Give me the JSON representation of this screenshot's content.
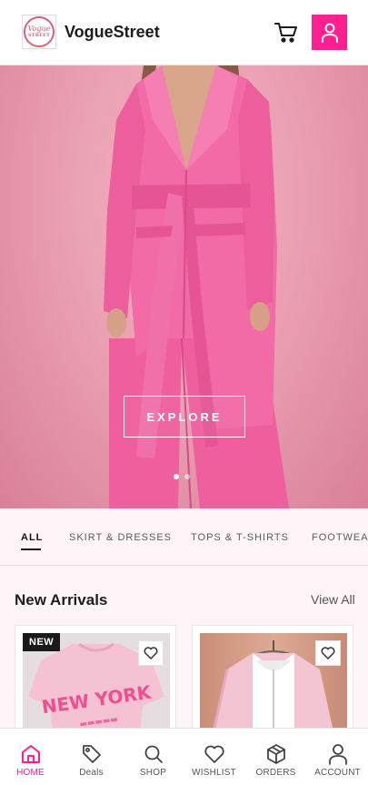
{
  "header": {
    "logo": {
      "line1": "Vogue",
      "line2": "STREET"
    },
    "brand": "VogueStreet",
    "cart_icon": "cart-icon",
    "account_icon": "user-icon"
  },
  "hero": {
    "cta_label": "EXPLORE",
    "slides": 2,
    "active_slide": 1
  },
  "tabs": [
    {
      "label": "ALL",
      "active": true
    },
    {
      "label": "SKIRT & DRESSES",
      "active": false
    },
    {
      "label": "TOPS & T-SHIRTS",
      "active": false
    },
    {
      "label": "FOOTWEAR",
      "active": false
    }
  ],
  "new_arrivals": {
    "title": "New Arrivals",
    "view_all": "View All",
    "products": [
      {
        "badge": "NEW",
        "image_text": "NEW YORK",
        "wishlist_icon": "heart-icon"
      },
      {
        "badge": "",
        "wishlist_icon": "heart-icon"
      }
    ]
  },
  "bottom_nav": [
    {
      "label": "HOME",
      "icon": "home-icon",
      "active": true
    },
    {
      "label": "Deals",
      "icon": "tag-icon",
      "active": false
    },
    {
      "label": "SHOP",
      "icon": "search-icon",
      "active": false
    },
    {
      "label": "WISHLIST",
      "icon": "heart-icon",
      "active": false
    },
    {
      "label": "ORDERS",
      "icon": "box-icon",
      "active": false
    },
    {
      "label": "ACCOUNT",
      "icon": "user-icon",
      "active": false
    }
  ],
  "colors": {
    "accent": "#ff1f8e",
    "hero_bg": "#eaa0b2",
    "page_bg": "#fff5f8"
  }
}
